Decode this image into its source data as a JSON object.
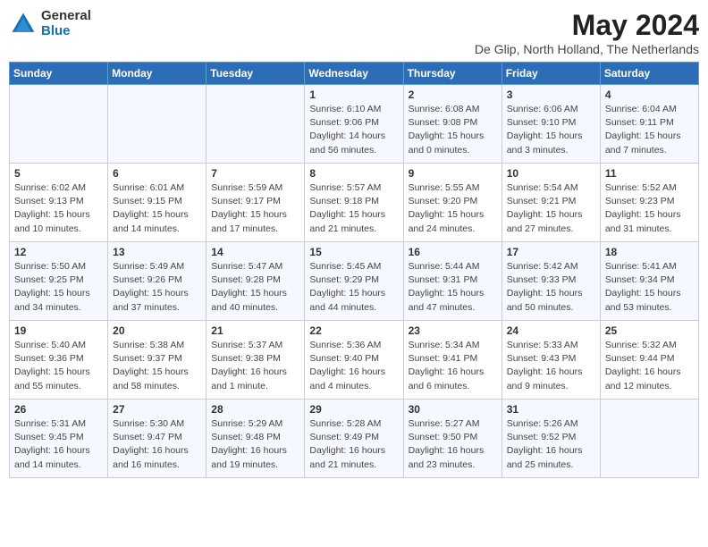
{
  "logo": {
    "general": "General",
    "blue": "Blue"
  },
  "title": {
    "month_year": "May 2024",
    "location": "De Glip, North Holland, The Netherlands"
  },
  "days_of_week": [
    "Sunday",
    "Monday",
    "Tuesday",
    "Wednesday",
    "Thursday",
    "Friday",
    "Saturday"
  ],
  "weeks": [
    [
      {
        "day": "",
        "info": ""
      },
      {
        "day": "",
        "info": ""
      },
      {
        "day": "",
        "info": ""
      },
      {
        "day": "1",
        "info": "Sunrise: 6:10 AM\nSunset: 9:06 PM\nDaylight: 14 hours\nand 56 minutes."
      },
      {
        "day": "2",
        "info": "Sunrise: 6:08 AM\nSunset: 9:08 PM\nDaylight: 15 hours\nand 0 minutes."
      },
      {
        "day": "3",
        "info": "Sunrise: 6:06 AM\nSunset: 9:10 PM\nDaylight: 15 hours\nand 3 minutes."
      },
      {
        "day": "4",
        "info": "Sunrise: 6:04 AM\nSunset: 9:11 PM\nDaylight: 15 hours\nand 7 minutes."
      }
    ],
    [
      {
        "day": "5",
        "info": "Sunrise: 6:02 AM\nSunset: 9:13 PM\nDaylight: 15 hours\nand 10 minutes."
      },
      {
        "day": "6",
        "info": "Sunrise: 6:01 AM\nSunset: 9:15 PM\nDaylight: 15 hours\nand 14 minutes."
      },
      {
        "day": "7",
        "info": "Sunrise: 5:59 AM\nSunset: 9:17 PM\nDaylight: 15 hours\nand 17 minutes."
      },
      {
        "day": "8",
        "info": "Sunrise: 5:57 AM\nSunset: 9:18 PM\nDaylight: 15 hours\nand 21 minutes."
      },
      {
        "day": "9",
        "info": "Sunrise: 5:55 AM\nSunset: 9:20 PM\nDaylight: 15 hours\nand 24 minutes."
      },
      {
        "day": "10",
        "info": "Sunrise: 5:54 AM\nSunset: 9:21 PM\nDaylight: 15 hours\nand 27 minutes."
      },
      {
        "day": "11",
        "info": "Sunrise: 5:52 AM\nSunset: 9:23 PM\nDaylight: 15 hours\nand 31 minutes."
      }
    ],
    [
      {
        "day": "12",
        "info": "Sunrise: 5:50 AM\nSunset: 9:25 PM\nDaylight: 15 hours\nand 34 minutes."
      },
      {
        "day": "13",
        "info": "Sunrise: 5:49 AM\nSunset: 9:26 PM\nDaylight: 15 hours\nand 37 minutes."
      },
      {
        "day": "14",
        "info": "Sunrise: 5:47 AM\nSunset: 9:28 PM\nDaylight: 15 hours\nand 40 minutes."
      },
      {
        "day": "15",
        "info": "Sunrise: 5:45 AM\nSunset: 9:29 PM\nDaylight: 15 hours\nand 44 minutes."
      },
      {
        "day": "16",
        "info": "Sunrise: 5:44 AM\nSunset: 9:31 PM\nDaylight: 15 hours\nand 47 minutes."
      },
      {
        "day": "17",
        "info": "Sunrise: 5:42 AM\nSunset: 9:33 PM\nDaylight: 15 hours\nand 50 minutes."
      },
      {
        "day": "18",
        "info": "Sunrise: 5:41 AM\nSunset: 9:34 PM\nDaylight: 15 hours\nand 53 minutes."
      }
    ],
    [
      {
        "day": "19",
        "info": "Sunrise: 5:40 AM\nSunset: 9:36 PM\nDaylight: 15 hours\nand 55 minutes."
      },
      {
        "day": "20",
        "info": "Sunrise: 5:38 AM\nSunset: 9:37 PM\nDaylight: 15 hours\nand 58 minutes."
      },
      {
        "day": "21",
        "info": "Sunrise: 5:37 AM\nSunset: 9:38 PM\nDaylight: 16 hours\nand 1 minute."
      },
      {
        "day": "22",
        "info": "Sunrise: 5:36 AM\nSunset: 9:40 PM\nDaylight: 16 hours\nand 4 minutes."
      },
      {
        "day": "23",
        "info": "Sunrise: 5:34 AM\nSunset: 9:41 PM\nDaylight: 16 hours\nand 6 minutes."
      },
      {
        "day": "24",
        "info": "Sunrise: 5:33 AM\nSunset: 9:43 PM\nDaylight: 16 hours\nand 9 minutes."
      },
      {
        "day": "25",
        "info": "Sunrise: 5:32 AM\nSunset: 9:44 PM\nDaylight: 16 hours\nand 12 minutes."
      }
    ],
    [
      {
        "day": "26",
        "info": "Sunrise: 5:31 AM\nSunset: 9:45 PM\nDaylight: 16 hours\nand 14 minutes."
      },
      {
        "day": "27",
        "info": "Sunrise: 5:30 AM\nSunset: 9:47 PM\nDaylight: 16 hours\nand 16 minutes."
      },
      {
        "day": "28",
        "info": "Sunrise: 5:29 AM\nSunset: 9:48 PM\nDaylight: 16 hours\nand 19 minutes."
      },
      {
        "day": "29",
        "info": "Sunrise: 5:28 AM\nSunset: 9:49 PM\nDaylight: 16 hours\nand 21 minutes."
      },
      {
        "day": "30",
        "info": "Sunrise: 5:27 AM\nSunset: 9:50 PM\nDaylight: 16 hours\nand 23 minutes."
      },
      {
        "day": "31",
        "info": "Sunrise: 5:26 AM\nSunset: 9:52 PM\nDaylight: 16 hours\nand 25 minutes."
      },
      {
        "day": "",
        "info": ""
      }
    ]
  ]
}
